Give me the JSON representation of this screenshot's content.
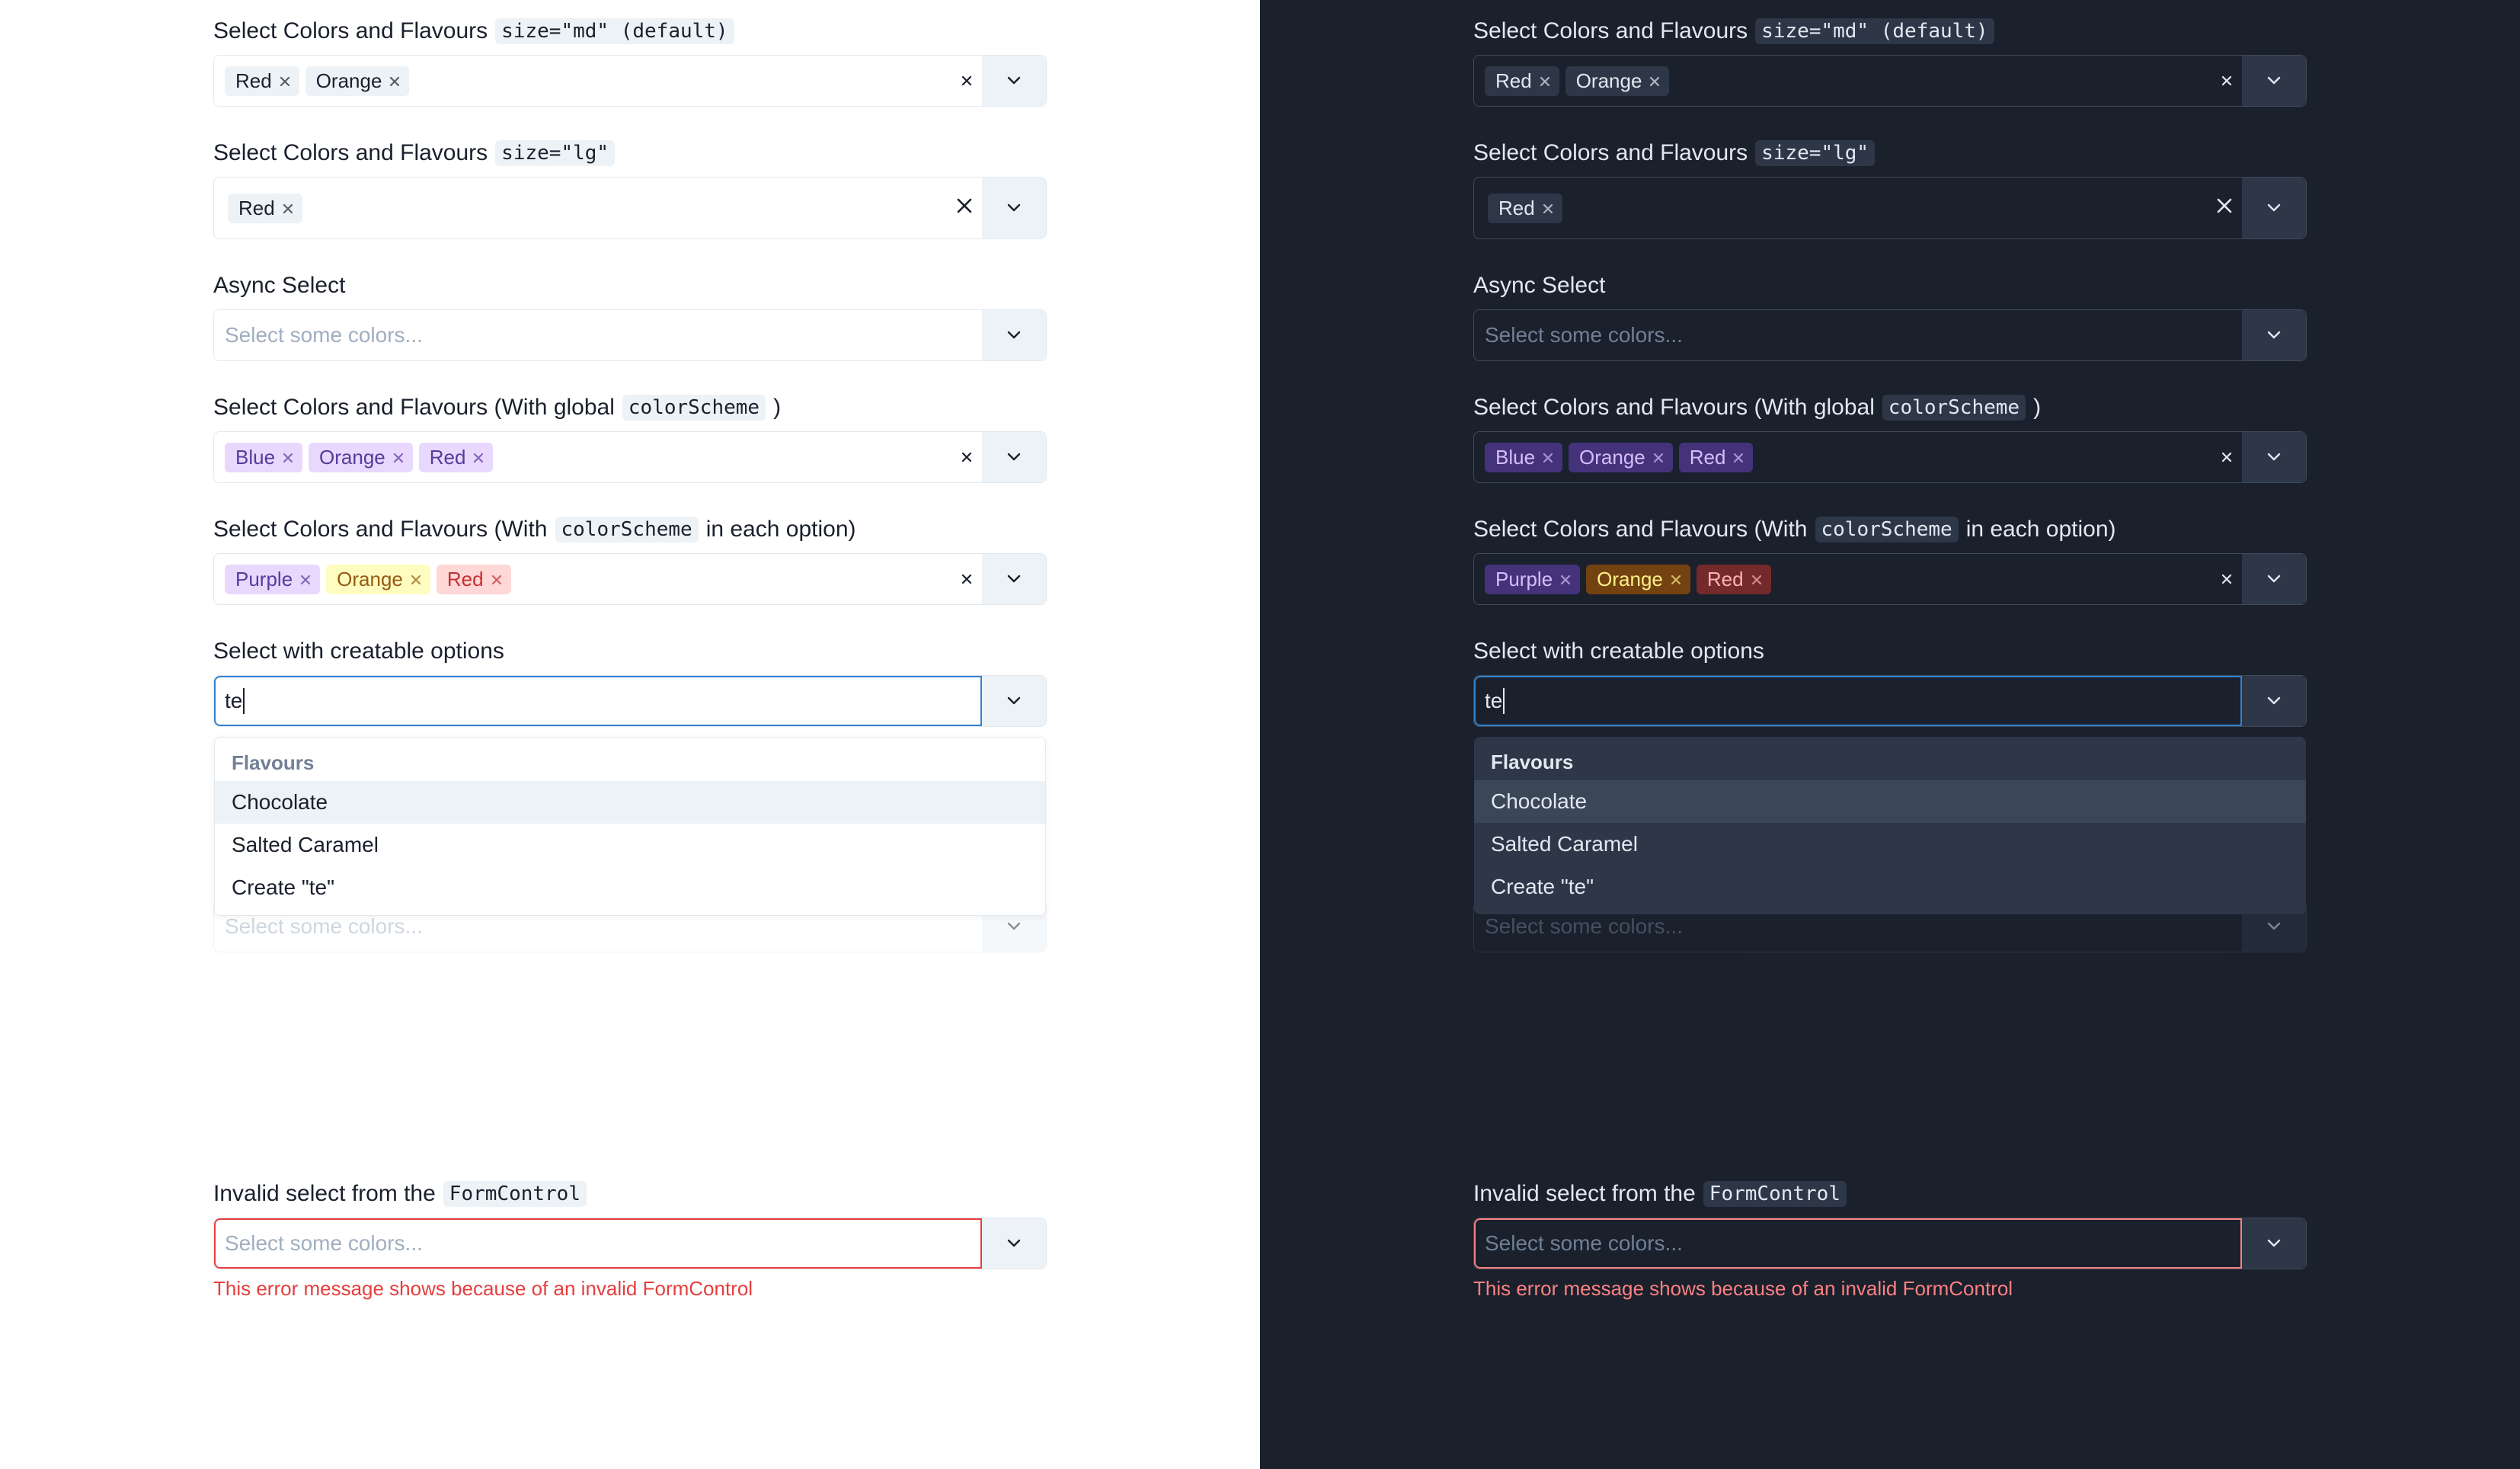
{
  "labels": {
    "select_colors_flavours": "Select Colors and Flavours",
    "size_md": "size=\"md\" (default)",
    "size_lg": "size=\"lg\"",
    "async_select": "Async Select",
    "with_global_pre": "Select Colors and Flavours (With global",
    "colorScheme": "colorScheme",
    "with_global_post": ")",
    "with_each_pre": "Select Colors and Flavours (With",
    "with_each_post": "in each option)",
    "creatable": "Select with creatable options",
    "invalid_pre": "Invalid select from the",
    "formControl": "FormControl"
  },
  "placeholder": "Select some colors...",
  "error_message": "This error message shows because of an invalid FormControl",
  "creatable_input": "te",
  "menu": {
    "group": "Flavours",
    "options": [
      "Chocolate",
      "Salted Caramel",
      "Create \"te\""
    ]
  },
  "fields": {
    "md": {
      "tags": [
        {
          "label": "Red",
          "color": "gray"
        },
        {
          "label": "Orange",
          "color": "gray"
        }
      ]
    },
    "lg": {
      "tags": [
        {
          "label": "Red",
          "color": "gray"
        }
      ]
    },
    "global": {
      "tags": [
        {
          "label": "Blue",
          "color": "purple"
        },
        {
          "label": "Orange",
          "color": "purple"
        },
        {
          "label": "Red",
          "color": "purple"
        }
      ]
    },
    "each": {
      "tags": [
        {
          "label": "Purple",
          "color": "purple"
        },
        {
          "label": "Orange",
          "color": "yellow"
        },
        {
          "label": "Red",
          "color": "red"
        }
      ]
    }
  }
}
